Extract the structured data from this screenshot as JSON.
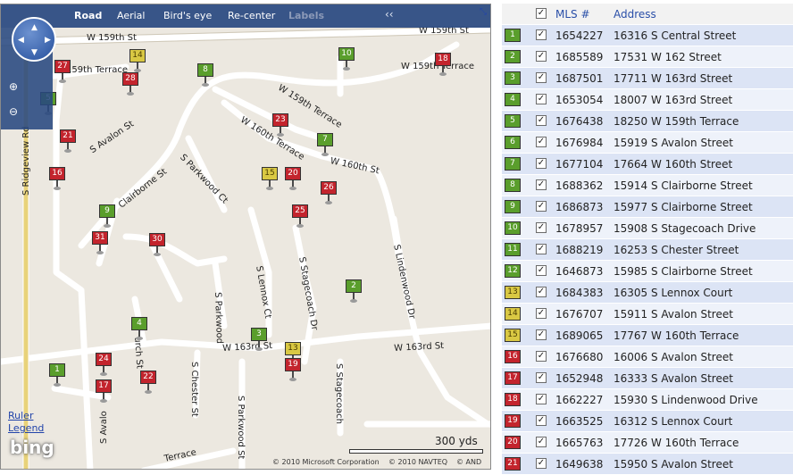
{
  "colors": {
    "toolbar": "#284880",
    "green": "#5a9e2c",
    "yellow": "#d9c843",
    "red": "#c3242d",
    "row_alt": "#dce4f5",
    "header_link": "#2a4fa8"
  },
  "toolbar": {
    "road": "Road",
    "aerial": "Aerial",
    "birds_eye": "Bird's eye",
    "recenter": "Re-center",
    "labels": "Labels",
    "collapse": "‹‹"
  },
  "nav": {
    "compass_icon": "compass-pan-icon",
    "zoom_in_icon": "zoom-in-icon",
    "zoom_out_icon": "zoom-out-icon"
  },
  "streets": {
    "w159th_st_left": "W 159th St",
    "w159th_st_right": "W 159th St",
    "w159th_terrace_top": "W 159th Terrace",
    "w159th_terrace_left": "W 159th Terrace",
    "w159th_terrace_mid": "W 159th Terrace",
    "s_ridgeview": "S Ridgeview Rd",
    "s_avalon": "S Avalon St",
    "s_avalon_bottom": "S Avalo",
    "w160th_terrace": "W 160th Terrace",
    "w160th_st": "W 160th St",
    "s_parkwood_ct": "S Parkwood Ct",
    "clairborne": "Clairborne St",
    "s_lindenwood": "S Lindenwood Dr",
    "s_stagecoach_dr": "S Stagecoach Dr",
    "s_lennox_ct": "S Lennox Ct",
    "s_parkwood": "S Parkwood",
    "s_chester": "S Chester St",
    "w163rd_st": "W 163rd St",
    "church": "urch St",
    "s_parkwood_st": "S Parkwood St",
    "s_stagecoach": "S Stagecoach",
    "terrace_bottom": "Terrace"
  },
  "map_links": {
    "ruler": "Ruler",
    "legend": "Legend"
  },
  "brand": "bing",
  "scale": "300 yds",
  "copyright": {
    "microsoft": "© 2010 Microsoft Corporation",
    "navteq": "© 2010 NAVTEQ",
    "and": "© AND"
  },
  "pins": [
    {
      "n": "1",
      "color": "green"
    },
    {
      "n": "2",
      "color": "green"
    },
    {
      "n": "3",
      "color": "green"
    },
    {
      "n": "4",
      "color": "green"
    },
    {
      "n": "5",
      "color": "green"
    },
    {
      "n": "7",
      "color": "green"
    },
    {
      "n": "8",
      "color": "green"
    },
    {
      "n": "9",
      "color": "green"
    },
    {
      "n": "10",
      "color": "green"
    },
    {
      "n": "13",
      "color": "yellow"
    },
    {
      "n": "14",
      "color": "yellow"
    },
    {
      "n": "15",
      "color": "yellow"
    },
    {
      "n": "16",
      "color": "red"
    },
    {
      "n": "17",
      "color": "red"
    },
    {
      "n": "18",
      "color": "red"
    },
    {
      "n": "19",
      "color": "red"
    },
    {
      "n": "20",
      "color": "red"
    },
    {
      "n": "21",
      "color": "red"
    },
    {
      "n": "22",
      "color": "red"
    },
    {
      "n": "23",
      "color": "red"
    },
    {
      "n": "24",
      "color": "red"
    },
    {
      "n": "25",
      "color": "red"
    },
    {
      "n": "26",
      "color": "red"
    },
    {
      "n": "27",
      "color": "red"
    },
    {
      "n": "28",
      "color": "red"
    },
    {
      "n": "30",
      "color": "red"
    },
    {
      "n": "31",
      "color": "red"
    }
  ],
  "list": {
    "header": {
      "mls": "MLS #",
      "address": "Address"
    },
    "rows": [
      {
        "n": "1",
        "color": "green",
        "mls": "1654227",
        "address": "16316 S Central Street"
      },
      {
        "n": "2",
        "color": "green",
        "mls": "1685589",
        "address": "17531 W 162 Street"
      },
      {
        "n": "3",
        "color": "green",
        "mls": "1687501",
        "address": "17711 W 163rd Street"
      },
      {
        "n": "4",
        "color": "green",
        "mls": "1653054",
        "address": "18007 W 163rd Street"
      },
      {
        "n": "5",
        "color": "green",
        "mls": "1676438",
        "address": "18250 W 159th Terrace"
      },
      {
        "n": "6",
        "color": "green",
        "mls": "1676984",
        "address": "15919 S Avalon Street"
      },
      {
        "n": "7",
        "color": "green",
        "mls": "1677104",
        "address": "17664 W 160th Street"
      },
      {
        "n": "8",
        "color": "green",
        "mls": "1688362",
        "address": "15914 S Clairborne Street"
      },
      {
        "n": "9",
        "color": "green",
        "mls": "1686873",
        "address": "15977 S Clairborne Street"
      },
      {
        "n": "10",
        "color": "green",
        "mls": "1678957",
        "address": "15908 S Stagecoach Drive"
      },
      {
        "n": "11",
        "color": "green",
        "mls": "1688219",
        "address": "16253 S Chester Street"
      },
      {
        "n": "12",
        "color": "green",
        "mls": "1646873",
        "address": "15985 S Clairborne Street"
      },
      {
        "n": "13",
        "color": "yellow",
        "mls": "1684383",
        "address": "16305 S Lennox Court"
      },
      {
        "n": "14",
        "color": "yellow",
        "mls": "1676707",
        "address": "15911 S Avalon Street"
      },
      {
        "n": "15",
        "color": "yellow",
        "mls": "1689065",
        "address": "17767 W 160th Terrace"
      },
      {
        "n": "16",
        "color": "red",
        "mls": "1676680",
        "address": "16006 S Avalon Street"
      },
      {
        "n": "17",
        "color": "red",
        "mls": "1652948",
        "address": "16333 S Avalon Street"
      },
      {
        "n": "18",
        "color": "red",
        "mls": "1662227",
        "address": "15930 S Lindenwood Drive"
      },
      {
        "n": "19",
        "color": "red",
        "mls": "1663525",
        "address": "16312 S Lennox Court"
      },
      {
        "n": "20",
        "color": "red",
        "mls": "1665763",
        "address": "17726 W 160th Terrace"
      },
      {
        "n": "21",
        "color": "red",
        "mls": "1649638",
        "address": "15950 S Avalon Street"
      }
    ]
  }
}
